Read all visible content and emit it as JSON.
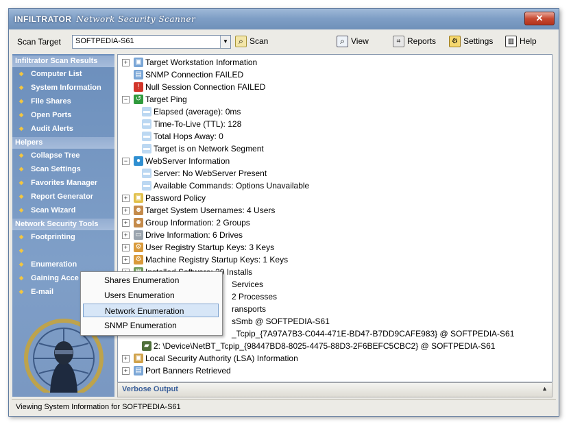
{
  "window": {
    "title_brand": "INFILTRATOR",
    "title_sub": "Network Security Scanner",
    "close_glyph": "✕"
  },
  "toolbar": {
    "scan_target_label": "Scan Target",
    "scan_target_value": "SOFTPEDIA-S61",
    "scan_label": "Scan",
    "view_label": "View",
    "reports_label": "Reports",
    "settings_label": "Settings",
    "help_label": "Help"
  },
  "sidebar": {
    "sections": [
      {
        "header": "Infiltrator Scan Results",
        "items": [
          "Computer List",
          "System Information",
          "File Shares",
          "Open Ports",
          "Audit Alerts"
        ]
      },
      {
        "header": "Helpers",
        "items": [
          "Collapse Tree",
          "Scan Settings",
          "Favorites Manager",
          "Report Generator",
          "Scan Wizard"
        ]
      },
      {
        "header": "Network Security Tools",
        "items": [
          "Footprinting",
          "",
          "Enumeration",
          "Gaining Acce",
          "E-mail"
        ]
      }
    ]
  },
  "tree": [
    {
      "text": "Target Workstation Information",
      "icon": "computer-icon",
      "level": 0,
      "exp": "+"
    },
    {
      "text": "SNMP Connection FAILED",
      "icon": "screen-icon",
      "level": 0,
      "exp": ""
    },
    {
      "text": "Null Session Connection FAILED",
      "icon": "error-icon",
      "level": 0,
      "exp": ""
    },
    {
      "text": "Target Ping",
      "icon": "ping-icon",
      "level": 0,
      "exp": "-"
    },
    {
      "text": "Elapsed (average): 0ms",
      "icon": "message-icon",
      "level": 1,
      "exp": ""
    },
    {
      "text": "Time-To-Live (TTL): 128",
      "icon": "message-icon",
      "level": 1,
      "exp": ""
    },
    {
      "text": "Total Hops Away: 0",
      "icon": "message-icon",
      "level": 1,
      "exp": ""
    },
    {
      "text": "Target is on Network Segment",
      "icon": "message-icon",
      "level": 1,
      "exp": ""
    },
    {
      "text": "WebServer Information",
      "icon": "globe-icon",
      "level": 0,
      "exp": "-"
    },
    {
      "text": "Server: No WebServer Present",
      "icon": "message-icon",
      "level": 1,
      "exp": ""
    },
    {
      "text": "Available Commands: Options Unavailable",
      "icon": "message-icon",
      "level": 1,
      "exp": ""
    },
    {
      "text": "Password Policy",
      "icon": "lock-icon",
      "level": 0,
      "exp": "+"
    },
    {
      "text": "Target System Usernames: 4 Users",
      "icon": "user-icon",
      "level": 0,
      "exp": "+"
    },
    {
      "text": "Group Information: 2 Groups",
      "icon": "group-icon",
      "level": 0,
      "exp": "+"
    },
    {
      "text": "Drive Information: 6 Drives",
      "icon": "drive-icon",
      "level": 0,
      "exp": "+"
    },
    {
      "text": "User Registry Startup Keys: 3 Keys",
      "icon": "registry-icon",
      "level": 0,
      "exp": "+"
    },
    {
      "text": "Machine Registry Startup Keys: 1 Keys",
      "icon": "registry-icon",
      "level": 0,
      "exp": "+"
    },
    {
      "text": "Installed Software: 29 Installs",
      "icon": "software-icon",
      "level": 0,
      "exp": "+"
    },
    {
      "text": "Services",
      "icon": "service-icon",
      "level": 0,
      "exp": "+",
      "covered": true
    },
    {
      "text": "2 Processes",
      "icon": "process-icon",
      "level": 0,
      "exp": "+",
      "covered": true
    },
    {
      "text": "ransports",
      "icon": "transport-icon",
      "level": 0,
      "exp": "-",
      "covered": true
    },
    {
      "text": "sSmb @ SOFTPEDIA-S61",
      "icon": "network-card-icon",
      "level": 1,
      "exp": "",
      "covered": true
    },
    {
      "text": "_Tcpip_{7A97A7B3-C044-471E-BD47-B7DD9CAFE983} @ SOFTPEDIA-S61",
      "icon": "network-card-icon",
      "level": 1,
      "exp": "",
      "covered": true
    },
    {
      "text": "2: \\Device\\NetBT_Tcpip_{98447BD8-8025-4475-88D3-2F6BEFC5CBC2} @ SOFTPEDIA-S61",
      "icon": "network-card-icon",
      "level": 1,
      "exp": ""
    },
    {
      "text": "Local Security Authority (LSA) Information",
      "icon": "lsa-icon",
      "level": 0,
      "exp": "+"
    },
    {
      "text": "Port Banners Retrieved",
      "icon": "port-icon",
      "level": 0,
      "exp": "+"
    }
  ],
  "context_menu": {
    "items": [
      "Shares Enumeration",
      "Users Enumeration",
      "Network Enumeration",
      "SNMP Enumeration"
    ],
    "selected_index": 2
  },
  "verbose": {
    "label": "Verbose Output",
    "arrow": "▲"
  },
  "status": {
    "text": "Viewing System Information for SOFTPEDIA-S61"
  },
  "colors": {
    "sidebar_bg": "#7a98c2",
    "title_bg": "#7f9fc6",
    "menu_highlight": "#d7e6f7",
    "accent_yellow": "#f3c640"
  }
}
